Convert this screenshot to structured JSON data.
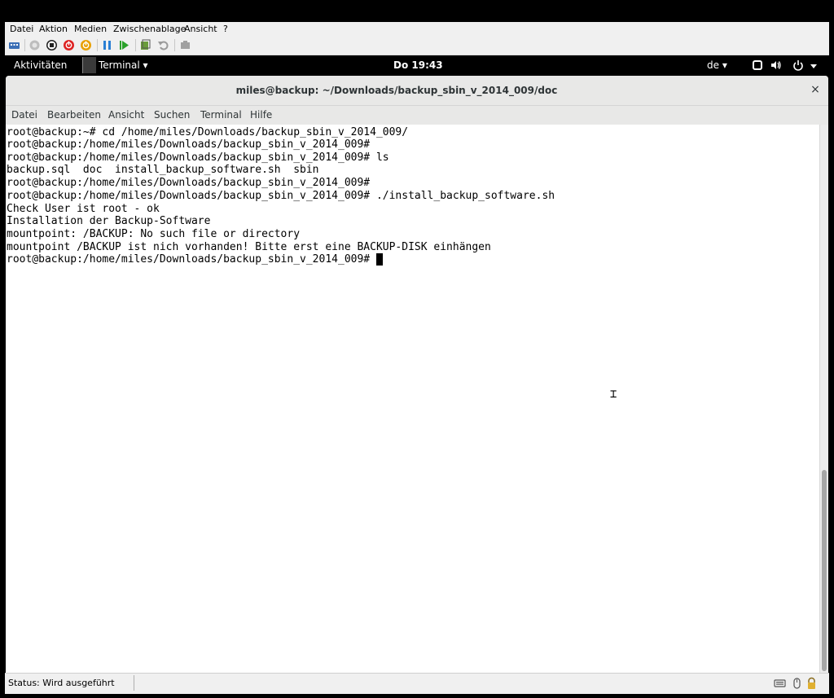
{
  "host": {
    "menu": [
      "Datei",
      "Aktion",
      "Medien",
      "Zwischenablage",
      "Ansicht",
      "?"
    ],
    "toolbar_icons": [
      "ctrl-alt-del-icon",
      "start-icon",
      "turn-off-icon",
      "shutdown-icon",
      "power-icon",
      "pause-icon",
      "reset-icon",
      "checkpoint-icon",
      "revert-icon",
      "enhanced-session-icon"
    ],
    "status": "Status: Wird ausgeführt"
  },
  "gnome": {
    "activities": "Aktivitäten",
    "app_menu": "Terminal ▾",
    "clock": "Do 19:43",
    "language": "de ▾"
  },
  "terminal": {
    "title": "miles@backup: ~/Downloads/backup_sbin_v_2014_009/doc",
    "close": "×",
    "menu": [
      "Datei",
      "Bearbeiten",
      "Ansicht",
      "Suchen",
      "Terminal",
      "Hilfe"
    ],
    "lines": [
      "root@backup:~# cd /home/miles/Downloads/backup_sbin_v_2014_009/",
      "root@backup:/home/miles/Downloads/backup_sbin_v_2014_009#",
      "root@backup:/home/miles/Downloads/backup_sbin_v_2014_009# ls",
      "backup.sql  doc  install_backup_software.sh  sbin",
      "root@backup:/home/miles/Downloads/backup_sbin_v_2014_009#",
      "root@backup:/home/miles/Downloads/backup_sbin_v_2014_009# ./install_backup_software.sh",
      "Check User ist root - ok",
      "Installation der Backup-Software",
      "mountpoint: /BACKUP: No such file or directory",
      "mountpoint /BACKUP ist nich vorhanden! Bitte erst eine BACKUP-DISK einhängen",
      "root@backup:/home/miles/Downloads/backup_sbin_v_2014_009# "
    ]
  }
}
